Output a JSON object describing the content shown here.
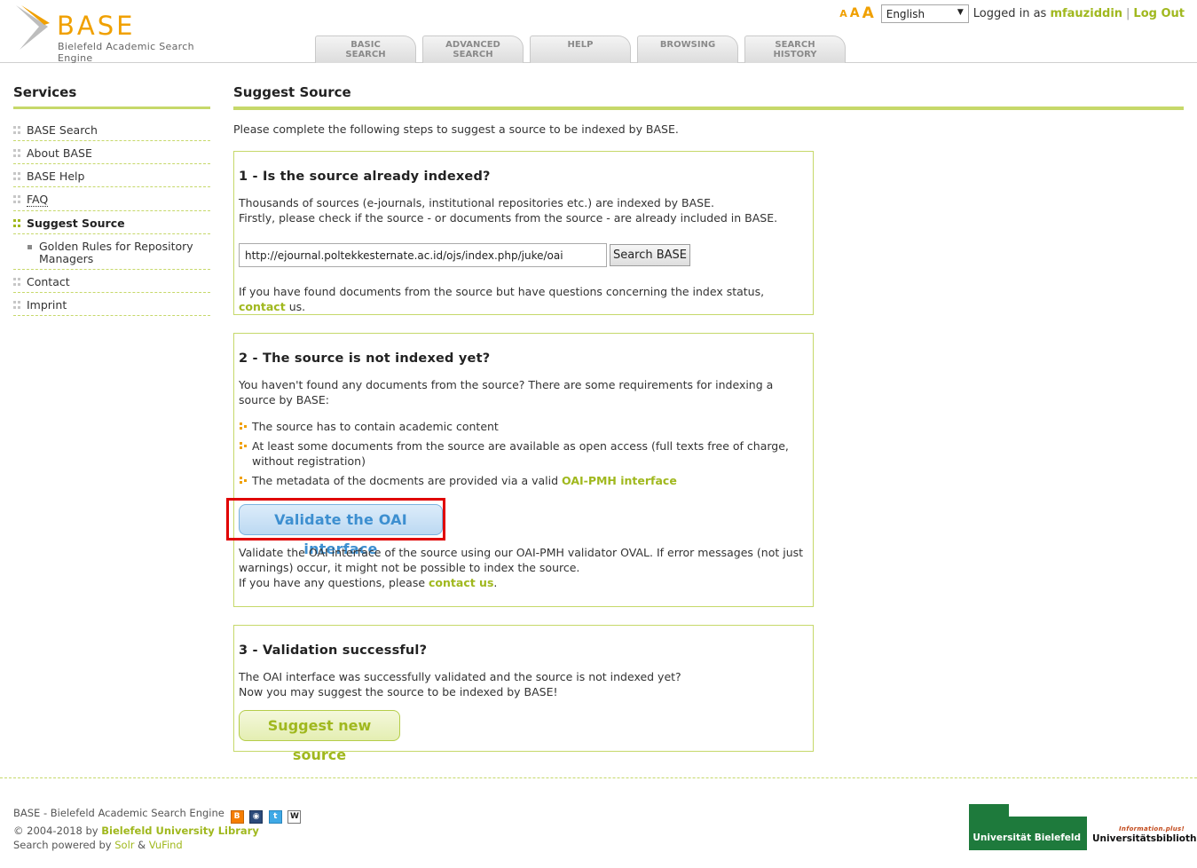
{
  "header": {
    "logo_text": "BASE",
    "logo_subtitle": "Bielefeld Academic Search Engine",
    "font_sizes": [
      "A",
      "A",
      "A"
    ],
    "language": "English",
    "logged_in_label": "Logged in as",
    "username": "mfauziddin",
    "separator": "|",
    "logout": "Log Out",
    "tabs": [
      {
        "line1": "BASIC",
        "line2": "SEARCH"
      },
      {
        "line1": "ADVANCED",
        "line2": "SEARCH"
      },
      {
        "line1": "HELP",
        "line2": ""
      },
      {
        "line1": "BROWSING",
        "line2": ""
      },
      {
        "line1": "SEARCH",
        "line2": "HISTORY"
      }
    ]
  },
  "sidebar": {
    "title": "Services",
    "items": [
      {
        "label": "BASE Search"
      },
      {
        "label": "About BASE"
      },
      {
        "label": "BASE Help"
      },
      {
        "label": "FAQ"
      },
      {
        "label": "Suggest Source"
      },
      {
        "label": "Golden Rules for Repository Managers"
      },
      {
        "label": "Contact"
      },
      {
        "label": "Imprint"
      }
    ]
  },
  "main": {
    "title": "Suggest Source",
    "intro": "Please complete the following steps to suggest a source to be indexed by BASE.",
    "step1": {
      "heading": "1 - Is the source already indexed?",
      "text1": "Thousands of sources (e-journals, institutional repositories etc.) are indexed by BASE.",
      "text2": "Firstly, please check if the source - or documents from the source - are already included in BASE.",
      "url_value": "http://ejournal.poltekkesternate.ac.id/ojs/index.php/juke/oai",
      "search_button": "Search BASE",
      "contact_pre": "If you have found documents from the source but have questions concerning the index status,",
      "contact_link": "contact",
      "contact_post": "us."
    },
    "step2": {
      "heading": "2 - The source is not indexed yet?",
      "text": "You haven't found any documents from the source? There are some requirements for indexing a source by BASE:",
      "req1": "The source has to contain academic content",
      "req2": "At least some documents from the source are available as open access (full texts free of charge, without registration)",
      "req3_pre": "The metadata of the docments are provided via a valid",
      "req3_link": "OAI-PMH interface",
      "validate_button": "Validate the OAI interface",
      "validate_text": "Validate the OAI interface of the source using our OAI-PMH validator OVAL. If error messages (not just warnings) occur, it might not be possible to index the source.",
      "questions_pre": "If you have any questions, please",
      "questions_link": "contact us",
      "questions_post": "."
    },
    "step3": {
      "heading": "3 - Validation successful?",
      "text1": "The OAI interface was successfully validated and the source is not indexed yet?",
      "text2": "Now you may suggest the source to be indexed by BASE!",
      "suggest_button": "Suggest new source"
    }
  },
  "footer": {
    "line1": "BASE - Bielefeld Academic Search Engine",
    "line2_pre": "© 2004-2018 by",
    "line2_link": "Bielefeld University Library",
    "line3_pre": "Search powered by",
    "solr": "Solr",
    "amp": "&",
    "vufind": "VuFind",
    "social_icons": [
      "blogger-icon",
      "eye-icon",
      "twitter-icon",
      "wikipedia-icon"
    ],
    "uni_logo_text": "Universität Bielefeld",
    "ub_plus": "Information.plus!",
    "ub_text": "Universitätsbibliothek"
  },
  "colors": {
    "accent_green": "#a0b81e",
    "accent_orange": "#f0a000",
    "highlight_red": "#e00000",
    "button_blue": "#3d8fd0"
  }
}
